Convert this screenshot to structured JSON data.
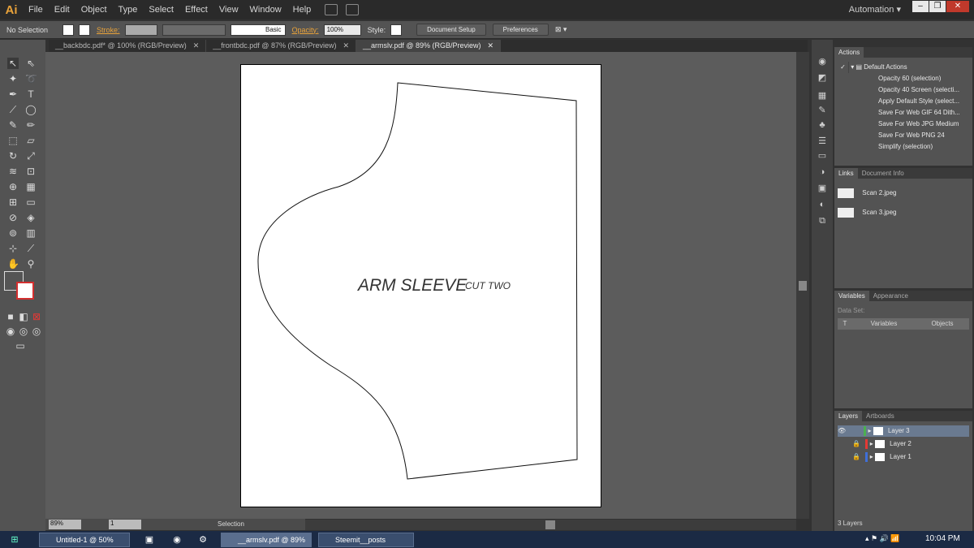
{
  "app": {
    "logo": "Ai",
    "workspace": "Automation"
  },
  "menu": [
    "File",
    "Edit",
    "Object",
    "Type",
    "Select",
    "Effect",
    "View",
    "Window",
    "Help"
  ],
  "control": {
    "selection": "No Selection",
    "stroke_label": "Stroke:",
    "brush_label": "Basic",
    "opacity_label": "Opacity:",
    "opacity_value": "100%",
    "style_label": "Style:",
    "doc_setup": "Document Setup",
    "preferences": "Preferences"
  },
  "tabs": [
    {
      "label": "__backbdc.pdf* @ 100% (RGB/Preview)",
      "active": false
    },
    {
      "label": "__frontbdc.pdf @ 87% (RGB/Preview)",
      "active": false
    },
    {
      "label": "__armslv.pdf @ 89% (RGB/Preview)",
      "active": true
    }
  ],
  "artboard": {
    "title": "ARM SLEEVE",
    "subtitle": "CUT TWO"
  },
  "status": {
    "zoom": "89%",
    "page": "1",
    "tool": "Selection"
  },
  "actions": {
    "title": "Actions",
    "items": [
      "Default Actions",
      "Opacity 60 (selection)",
      "Opacity 40 Screen (selecti...",
      "Apply Default Style (select...",
      "Save For Web GIF 64 Dith...",
      "Save For Web JPG Medium",
      "Save For Web PNG 24",
      "Simplify (selection)"
    ]
  },
  "links": {
    "tab1": "Links",
    "tab2": "Document Info",
    "items": [
      "Scan 2.jpeg",
      "Scan 3.jpeg"
    ]
  },
  "variables": {
    "tab1": "Variables",
    "tab2": "Appearance",
    "dataset_label": "Data Set:",
    "col_t": "T",
    "col_variables": "Variables",
    "col_objects": "Objects"
  },
  "layers": {
    "tab1": "Layers",
    "tab2": "Artboards",
    "items": [
      {
        "name": "Layer 3",
        "color": "#4caf50"
      },
      {
        "name": "Layer 2",
        "color": "#e53935"
      },
      {
        "name": "Layer 1",
        "color": "#3f6fd8"
      }
    ],
    "count": "3 Layers"
  },
  "taskbar": {
    "items": [
      "Untitled-1 @ 50% (La...",
      "__armslv.pdf @ 89% ...",
      "Steemit__posts"
    ],
    "time": "10:04 PM"
  }
}
